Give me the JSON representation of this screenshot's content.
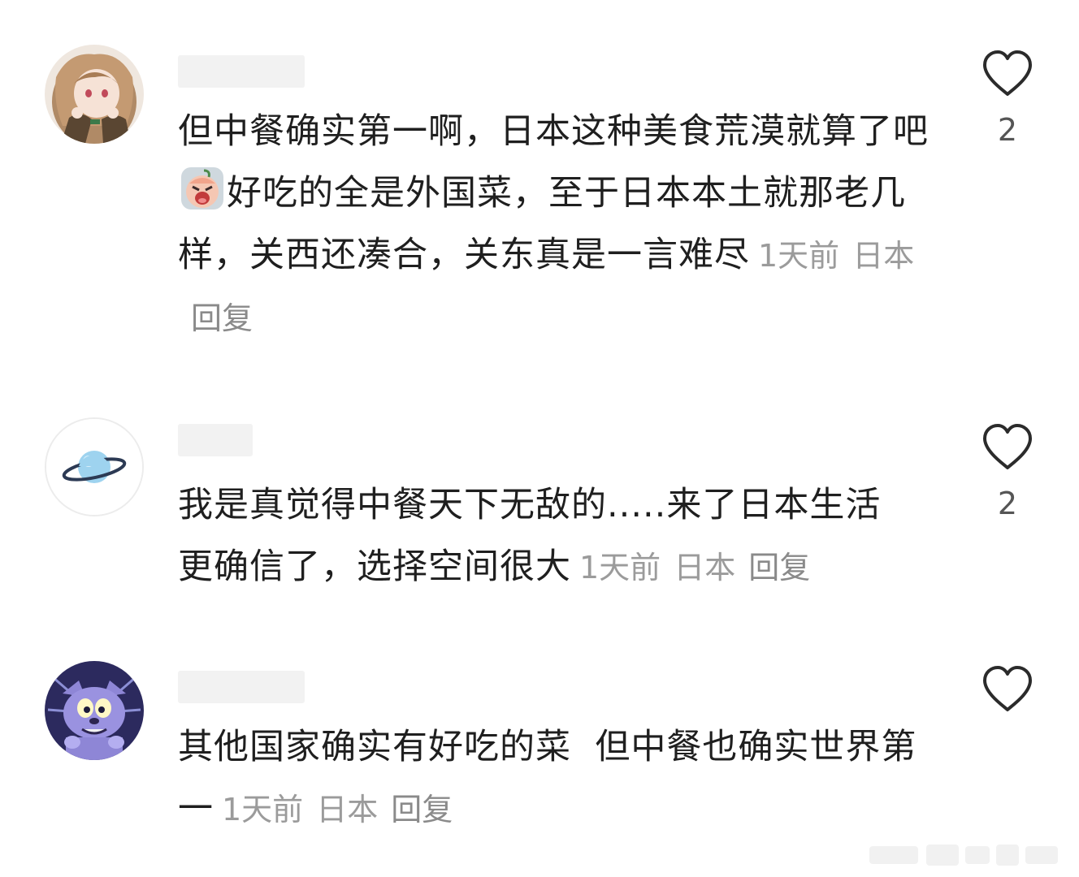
{
  "comments": [
    {
      "text_before_emoji": "但中餐确实第一啊，日本这种美食荒漠就算了吧",
      "emoji": "crying-face-emoji",
      "text_after_emoji": "好吃的全是外国菜，至于日本本土就那老几样，关西还凑合，关东真是一言难尽",
      "time": "1天前",
      "location": "日本",
      "reply_label": "回复",
      "likes": "2",
      "avatar": "anime-girl-avatar"
    },
    {
      "text": "我是真觉得中餐天下无敌的.....来了日本生活更确信了，选择空间很大",
      "time": "1天前",
      "location": "日本",
      "reply_label": "回复",
      "likes": "2",
      "avatar": "planet-avatar"
    },
    {
      "text": "其他国家确实有好吃的菜  但中餐也确实世界第一",
      "time": "1天前",
      "location": "日本",
      "reply_label": "回复",
      "likes": "",
      "avatar": "cartoon-cat-avatar"
    }
  ],
  "icons": {
    "like": "heart-outline-icon"
  },
  "colors": {
    "text": "#1f1f1f",
    "meta": "#9b9b9b",
    "heart_stroke": "#2b2b2b",
    "username_placeholder": "#f2f2f2"
  }
}
